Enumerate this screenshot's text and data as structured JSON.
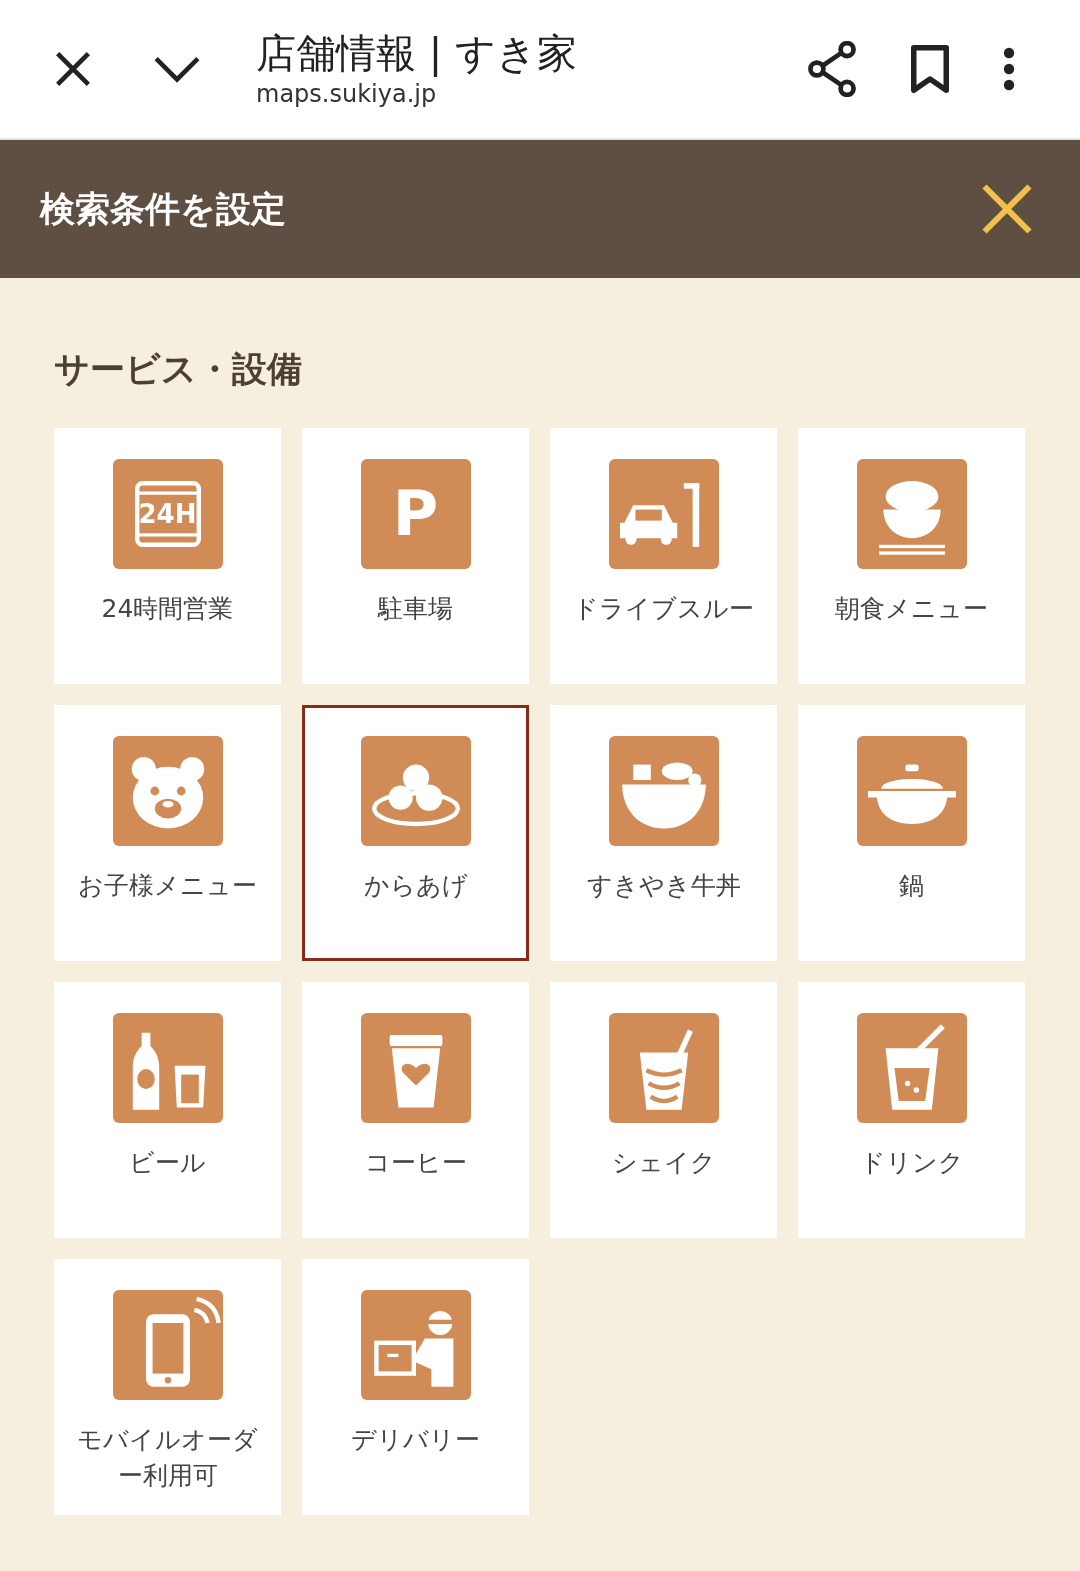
{
  "browser": {
    "title": "店舗情報 | すき家",
    "url": "maps.sukiya.jp"
  },
  "panel": {
    "title": "検索条件を設定"
  },
  "section": {
    "title": "サービス・設備"
  },
  "items": [
    {
      "label": "24時間営業",
      "kind": "allday",
      "icon_text": "24H",
      "selected": false
    },
    {
      "label": "駐車場",
      "kind": "parking",
      "icon_text": "P",
      "selected": false
    },
    {
      "label": "ドライブスルー",
      "kind": "drive",
      "selected": false
    },
    {
      "label": "朝食メニュー",
      "kind": "breakfast",
      "selected": false
    },
    {
      "label": "お子様メニュー",
      "kind": "kids",
      "selected": false
    },
    {
      "label": "からあげ",
      "kind": "karaage",
      "selected": true
    },
    {
      "label": "すきやき牛丼",
      "kind": "sukiyaki",
      "selected": false
    },
    {
      "label": "鍋",
      "kind": "nabe",
      "selected": false
    },
    {
      "label": "ビール",
      "kind": "beer",
      "selected": false
    },
    {
      "label": "コーヒー",
      "kind": "coffee",
      "selected": false
    },
    {
      "label": "シェイク",
      "kind": "shake",
      "selected": false
    },
    {
      "label": "ドリンク",
      "kind": "drink",
      "selected": false
    },
    {
      "label": "モバイルオーダー利用可",
      "kind": "mobile",
      "selected": false
    },
    {
      "label": "デリバリー",
      "kind": "delivery",
      "selected": false
    }
  ]
}
